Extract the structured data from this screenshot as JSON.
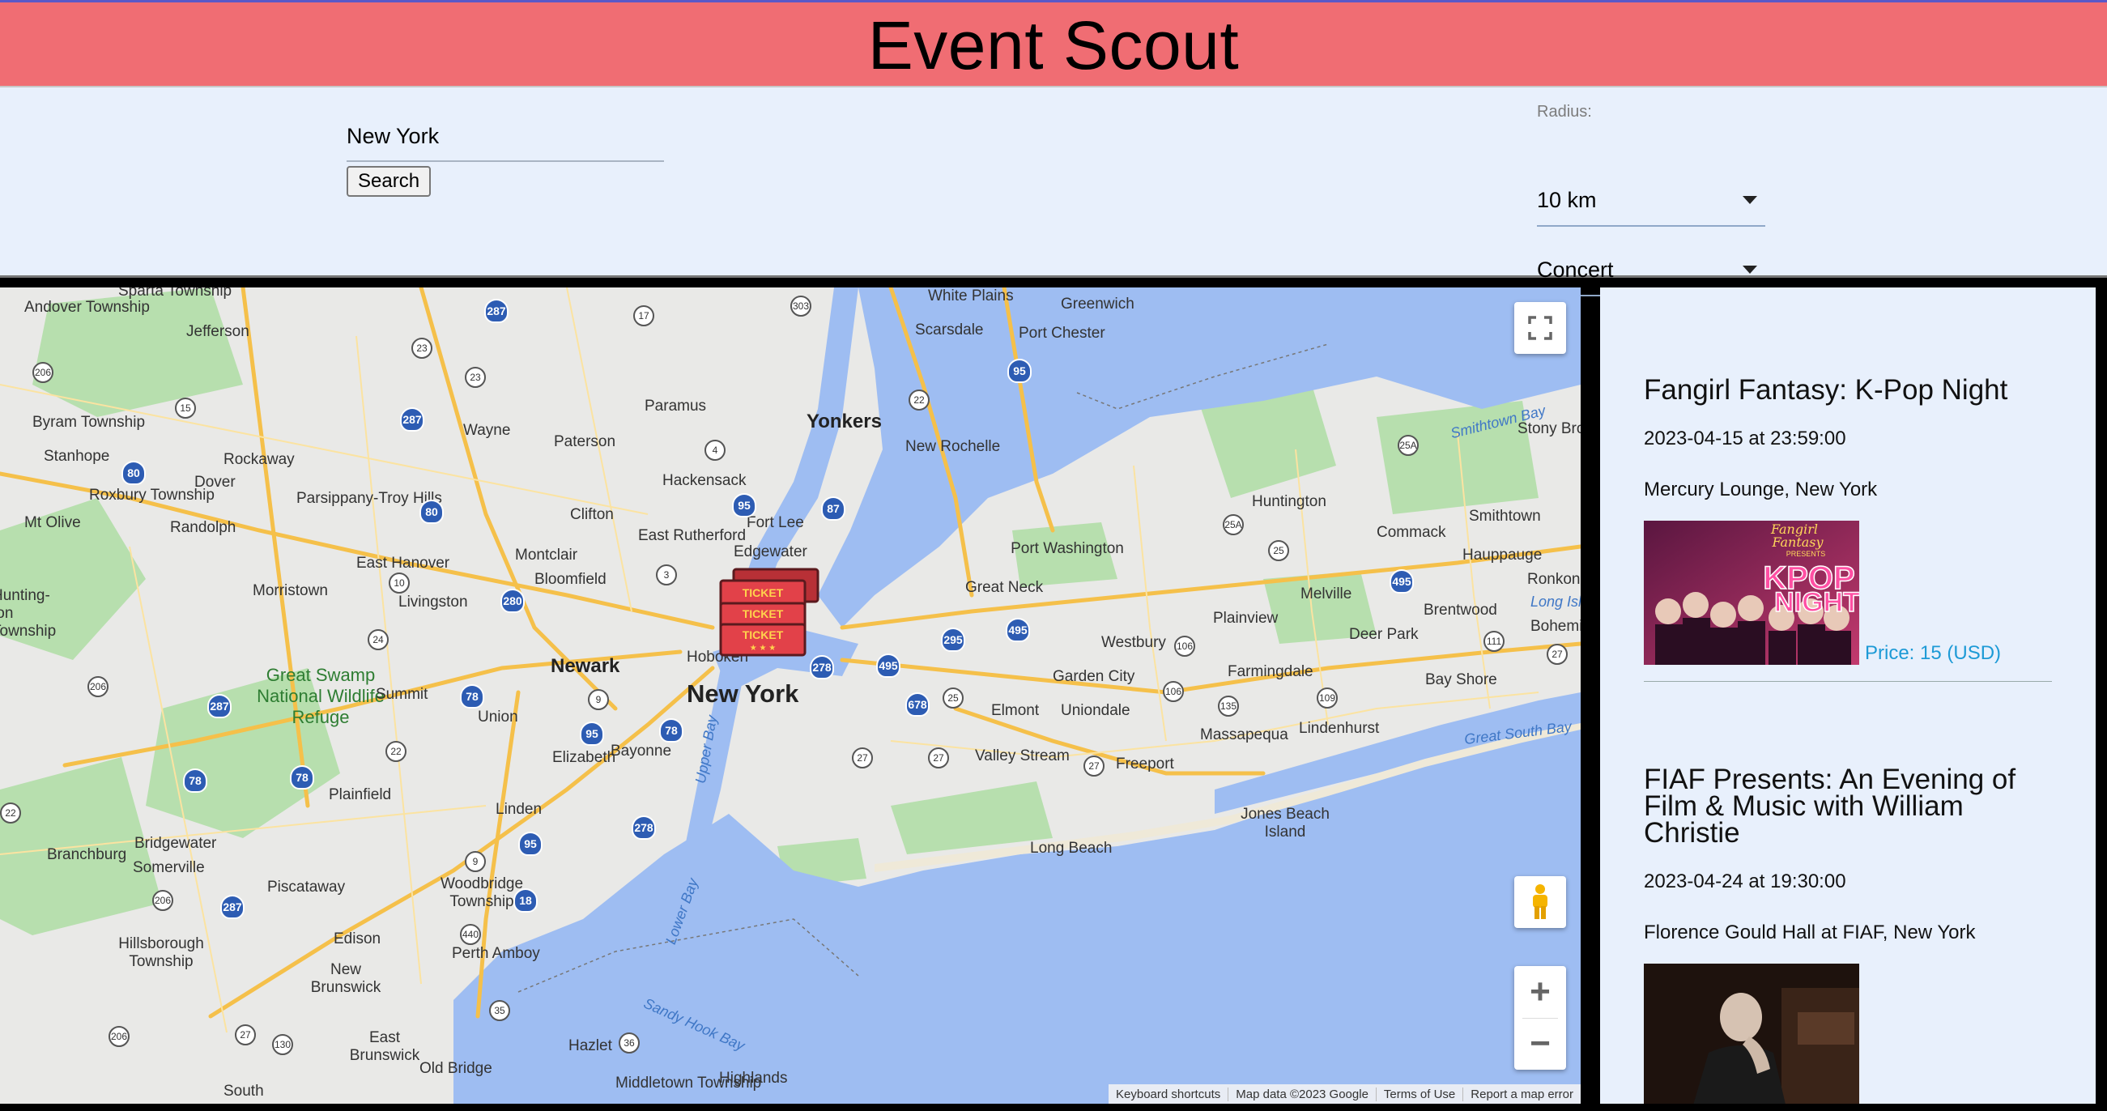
{
  "app": {
    "title": "Event Scout"
  },
  "search": {
    "city_value": "New York",
    "button_label": "Search"
  },
  "filters": {
    "radius_label": "Radius:",
    "radius_value": "10 km",
    "category_value": "Concert"
  },
  "map": {
    "labels": [
      "Andover Township",
      "Jefferson",
      "Sparta Township",
      "Byram Township",
      "Stanhope",
      "Roxbury Township",
      "Mt Olive",
      "Dover",
      "Rockaway",
      "Randolph",
      "Parsippany-Troy Hills",
      "Wayne",
      "Paterson",
      "Clifton",
      "Paramus",
      "Hackensack",
      "Yonkers",
      "White Plains",
      "Greenwich",
      "Scarsdale",
      "Port Chester",
      "New Rochelle",
      "Fort Lee",
      "Edgewater",
      "East Rutherford",
      "Montclair",
      "Bloomfield",
      "East Hanover",
      "Morristown",
      "Livingston",
      "Newark",
      "New York",
      "Hoboken",
      "Great Swamp National Wildlife Refuge",
      "Summit",
      "Union",
      "Elizabeth",
      "Bayonne",
      "Plainfield",
      "Linden",
      "Bridgewater",
      "Somerville",
      "Branchburg",
      "Piscataway",
      "Woodbridge Township",
      "Perth Amboy",
      "Edison",
      "New Brunswick",
      "Hillsborough Township",
      "East Brunswick",
      "Old Bridge",
      "Hazlet",
      "Middletown Township",
      "Highlands",
      "South",
      "Port Washington",
      "Great Neck",
      "Huntington",
      "Plainview",
      "Westbury",
      "Garden City",
      "Uniondale",
      "Elmont",
      "Valley Stream",
      "Freeport",
      "Long Beach",
      "Massapequa",
      "Lindenhurst",
      "Farmingdale",
      "Deer Park",
      "Melville",
      "Commack",
      "Smithtown",
      "Hauppauge",
      "Brentwood",
      "Bay Shore",
      "Stony Brook",
      "Jones Beach Island",
      "Ronkonkoma",
      "Bohemia",
      "Hunting-ton Township"
    ],
    "water_labels": [
      "Smithtown Bay",
      "Great South Bay",
      "Upper Bay",
      "Lower Bay",
      "Sandy Hook Bay",
      "Long Island"
    ],
    "attribution": [
      "Keyboard shortcuts",
      "Map data ©2023 Google",
      "Terms of Use",
      "Report a map error"
    ],
    "marker_text": "TICKET"
  },
  "events": [
    {
      "title": "Fangirl Fantasy: K-Pop Night",
      "date": "2023-04-15 at 23:59:00",
      "venue": "Mercury Lounge, New York",
      "price": "Price: 15 (USD)",
      "image_text": [
        "Fangirl",
        "Fantasy",
        "PRESENTS",
        "KPOP",
        "NIGHT"
      ]
    },
    {
      "title": "FIAF Presents: An Evening of Film & Music with William Christie",
      "date": "2023-04-24 at 19:30:00",
      "venue": "Florence Gould Hall at FIAF, New York"
    }
  ],
  "colors": {
    "header_bg": "#f06d73",
    "panel_bg": "#e8f0fc",
    "price": "#1d9ad6",
    "map_water": "#9ebdf2",
    "map_land": "#e8e8e6",
    "map_park": "#a8d8a0"
  }
}
